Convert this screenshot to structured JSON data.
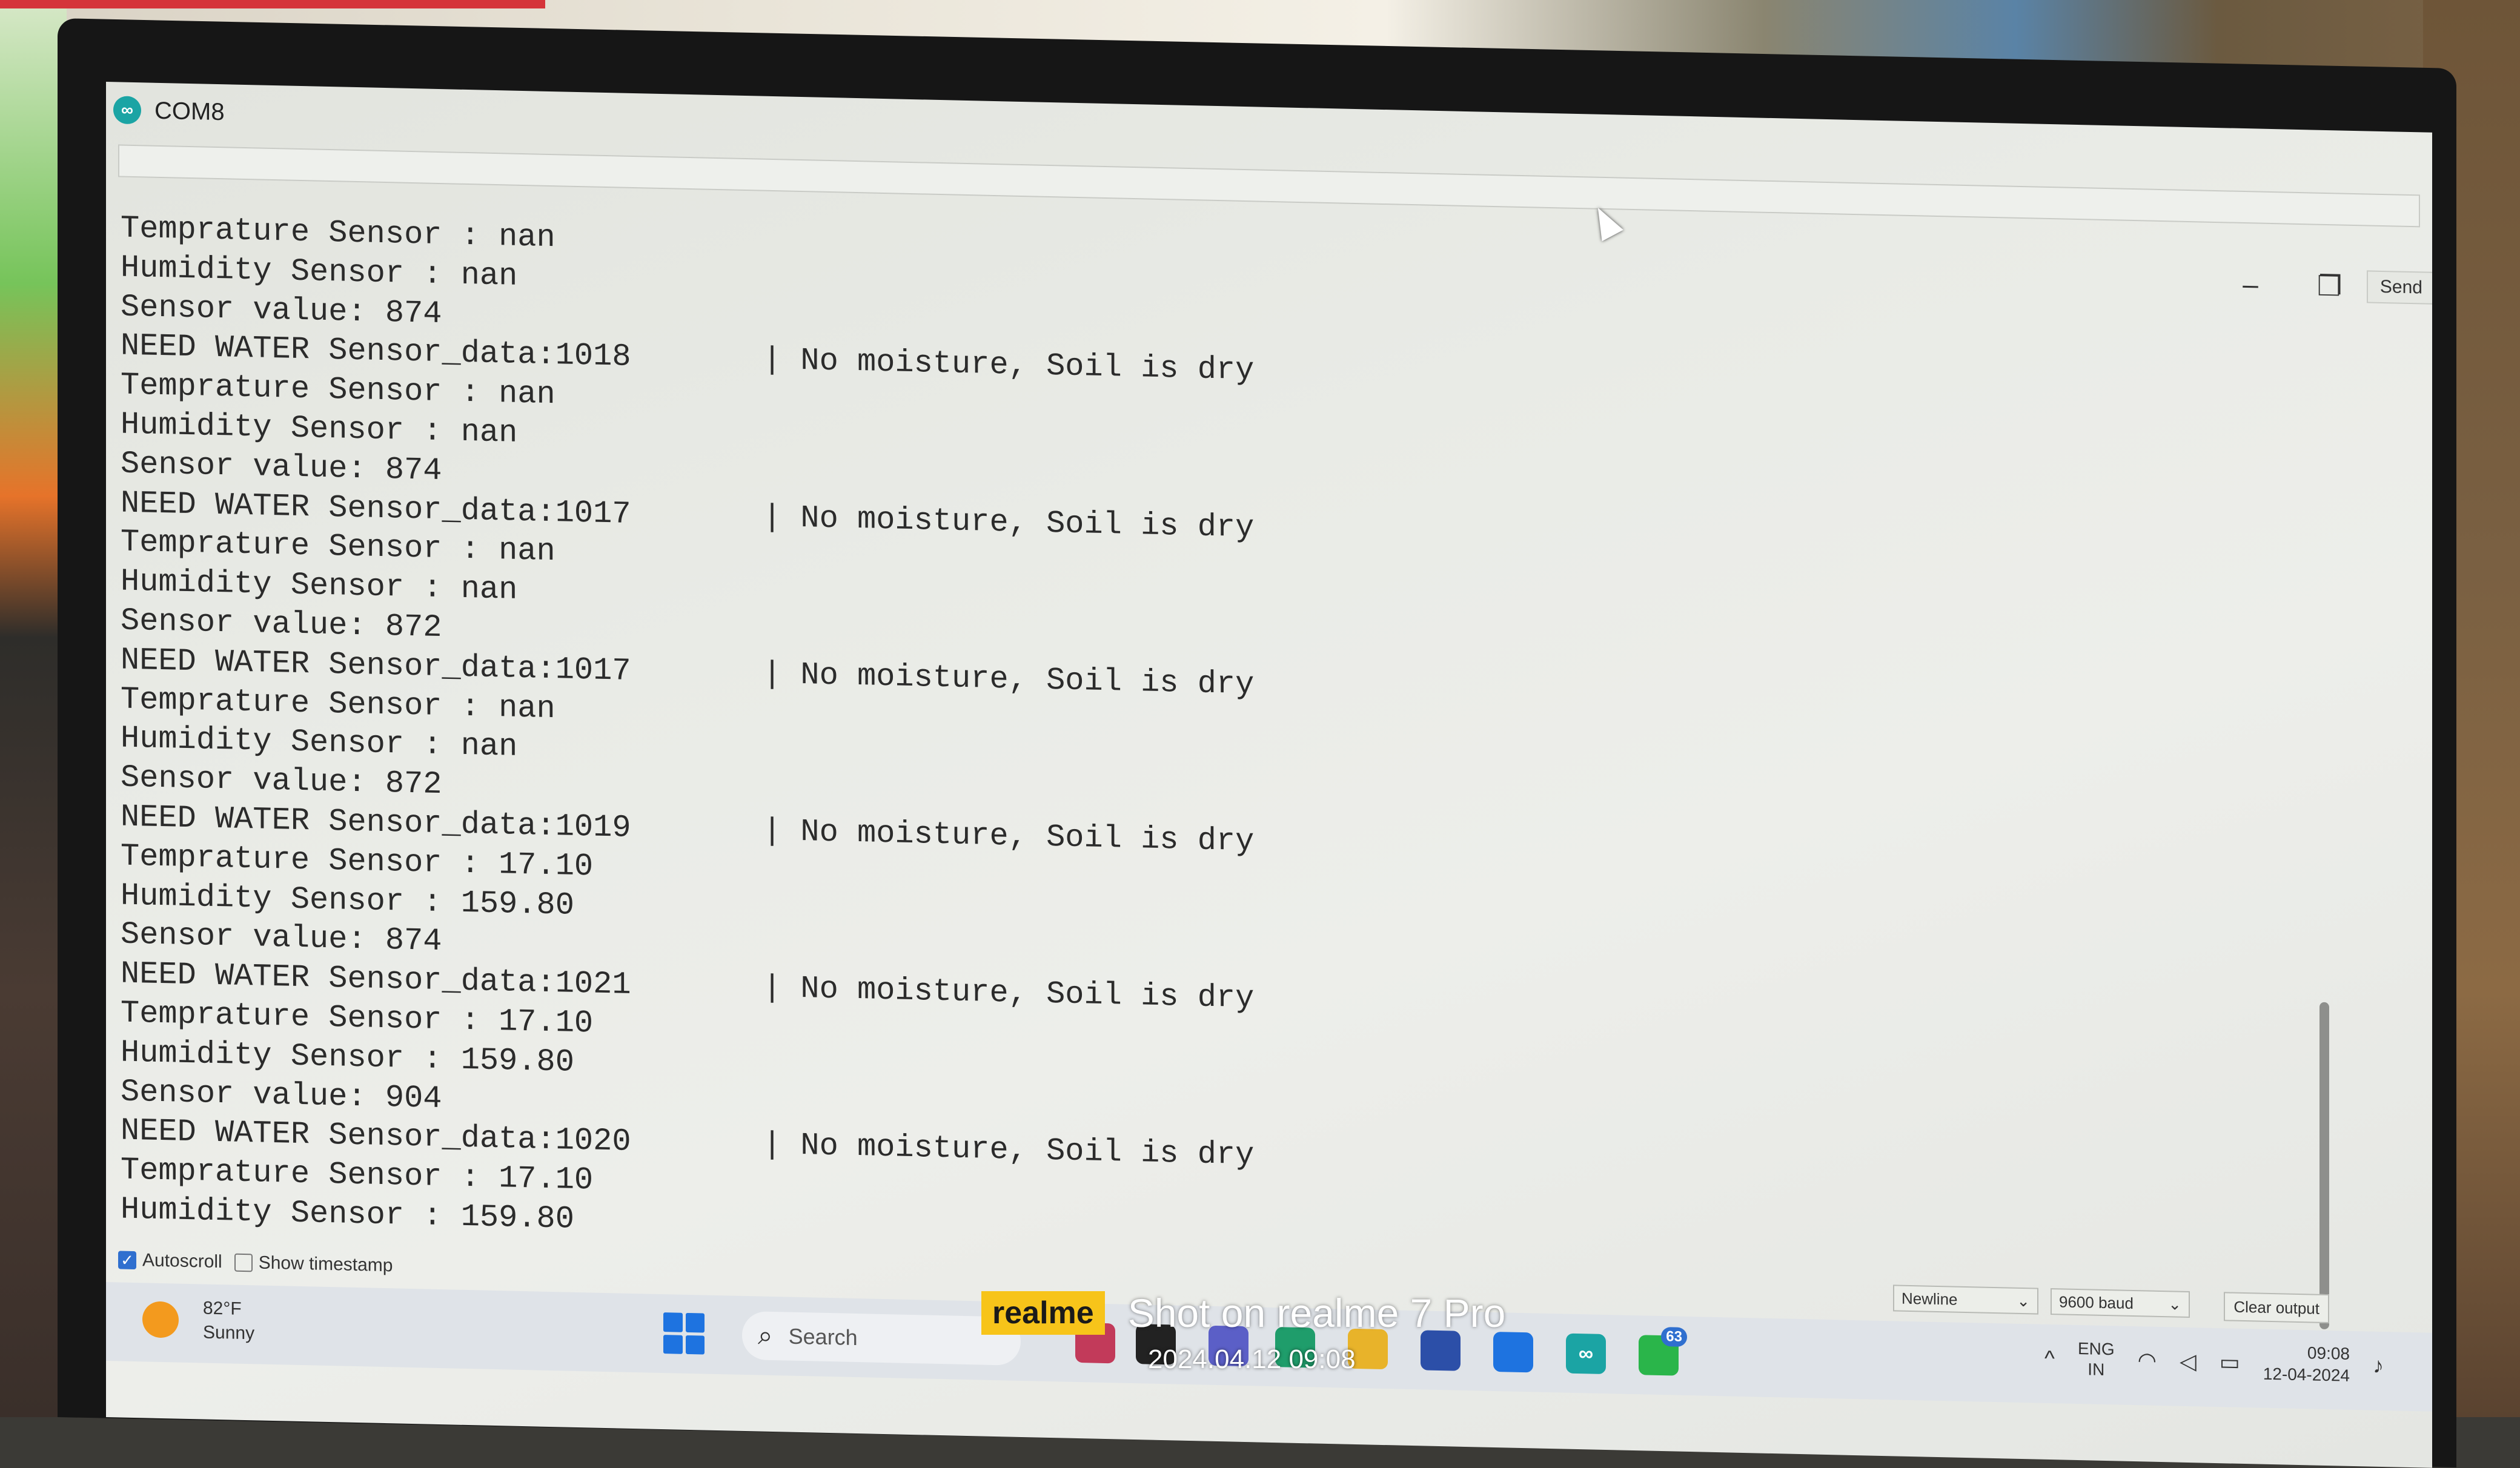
{
  "window": {
    "title": "COM8",
    "controls": {
      "minimize": "–",
      "restore": "❐",
      "close": "✕"
    }
  },
  "toolbar": {
    "send_input_value": "",
    "send_label": "Send"
  },
  "serial_output": [
    {
      "text": "Temprature Sensor : nan",
      "right": ""
    },
    {
      "text": "Humidity Sensor : nan",
      "right": ""
    },
    {
      "text": "Sensor value: 874",
      "right": ""
    },
    {
      "text": "NEED WATER Sensor_data:1018",
      "right": "| No moisture, Soil is dry"
    },
    {
      "text": "Temprature Sensor : nan",
      "right": ""
    },
    {
      "text": "Humidity Sensor : nan",
      "right": ""
    },
    {
      "text": "Sensor value: 874",
      "right": ""
    },
    {
      "text": "NEED WATER Sensor_data:1017",
      "right": "| No moisture, Soil is dry"
    },
    {
      "text": "Temprature Sensor : nan",
      "right": ""
    },
    {
      "text": "Humidity Sensor : nan",
      "right": ""
    },
    {
      "text": "Sensor value: 872",
      "right": ""
    },
    {
      "text": "NEED WATER Sensor_data:1017",
      "right": "| No moisture, Soil is dry"
    },
    {
      "text": "Temprature Sensor : nan",
      "right": ""
    },
    {
      "text": "Humidity Sensor : nan",
      "right": ""
    },
    {
      "text": "Sensor value: 872",
      "right": ""
    },
    {
      "text": "NEED WATER Sensor_data:1019",
      "right": "| No moisture, Soil is dry"
    },
    {
      "text": "Temprature Sensor : 17.10",
      "right": ""
    },
    {
      "text": "Humidity Sensor : 159.80",
      "right": ""
    },
    {
      "text": "Sensor value: 874",
      "right": ""
    },
    {
      "text": "NEED WATER Sensor_data:1021",
      "right": "| No moisture, Soil is dry"
    },
    {
      "text": "Temprature Sensor : 17.10",
      "right": ""
    },
    {
      "text": "Humidity Sensor : 159.80",
      "right": ""
    },
    {
      "text": "Sensor value: 904",
      "right": ""
    },
    {
      "text": "NEED WATER Sensor_data:1020",
      "right": "| No moisture, Soil is dry"
    },
    {
      "text": "Temprature Sensor : 17.10",
      "right": ""
    },
    {
      "text": "Humidity Sensor : 159.80",
      "right": ""
    }
  ],
  "bottom_bar": {
    "autoscroll_label": "Autoscroll",
    "autoscroll_checked": true,
    "timestamp_label": "Show timestamp",
    "timestamp_checked": false,
    "line_ending": "Newline",
    "baud_rate": "9600 baud",
    "clear_label": "Clear output"
  },
  "taskbar": {
    "weather_temp": "82°F",
    "weather_cond": "Sunny",
    "search_label": "Search",
    "whatsapp_badge": "63",
    "lang_top": "ENG",
    "lang_bottom": "IN",
    "time": "09:08",
    "date": "12-04-2024"
  },
  "watermark": {
    "brand": "realme",
    "text": "Shot on realme 7 Pro",
    "datetime": "2024.04.12 09:08"
  },
  "colors": {
    "accent": "#2f6fcf",
    "arduino_teal": "#1ba4a4",
    "watermark_yellow": "#f7c41a"
  },
  "icons": [
    "arduino-icon",
    "minimize-icon",
    "restore-icon",
    "close-icon",
    "checkbox-icon",
    "chevron-down-icon",
    "windows-start-icon",
    "search-icon",
    "wifi-icon",
    "speaker-icon",
    "battery-icon",
    "bell-icon",
    "cursor-icon"
  ]
}
